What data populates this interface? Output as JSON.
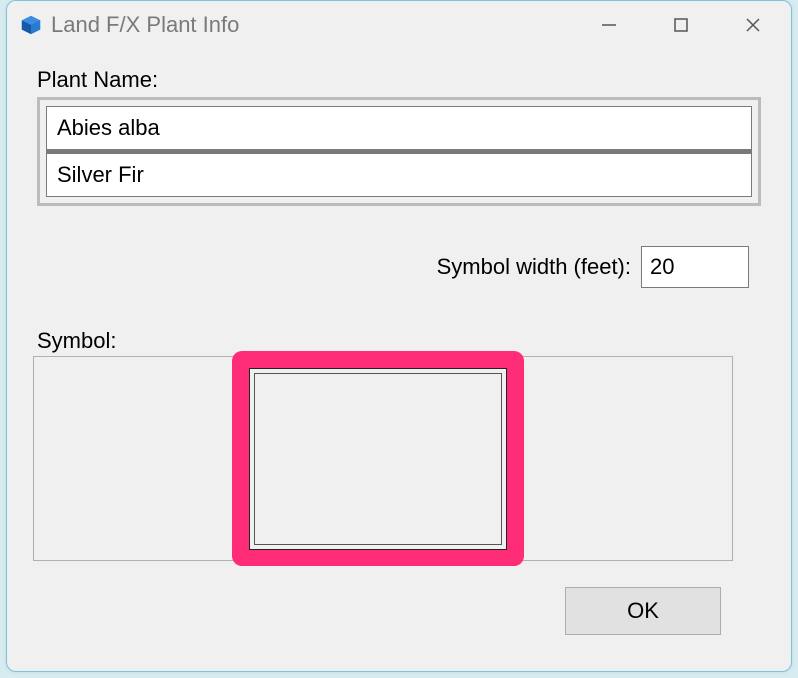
{
  "window": {
    "title": "Land F/X Plant Info"
  },
  "labels": {
    "plant_name": "Plant Name:",
    "symbol_width": "Symbol width (feet):",
    "symbol": "Symbol:"
  },
  "plant": {
    "scientific_name": "Abies alba",
    "common_name": "Silver Fir"
  },
  "symbol_width_value": "20",
  "buttons": {
    "ok": "OK"
  }
}
